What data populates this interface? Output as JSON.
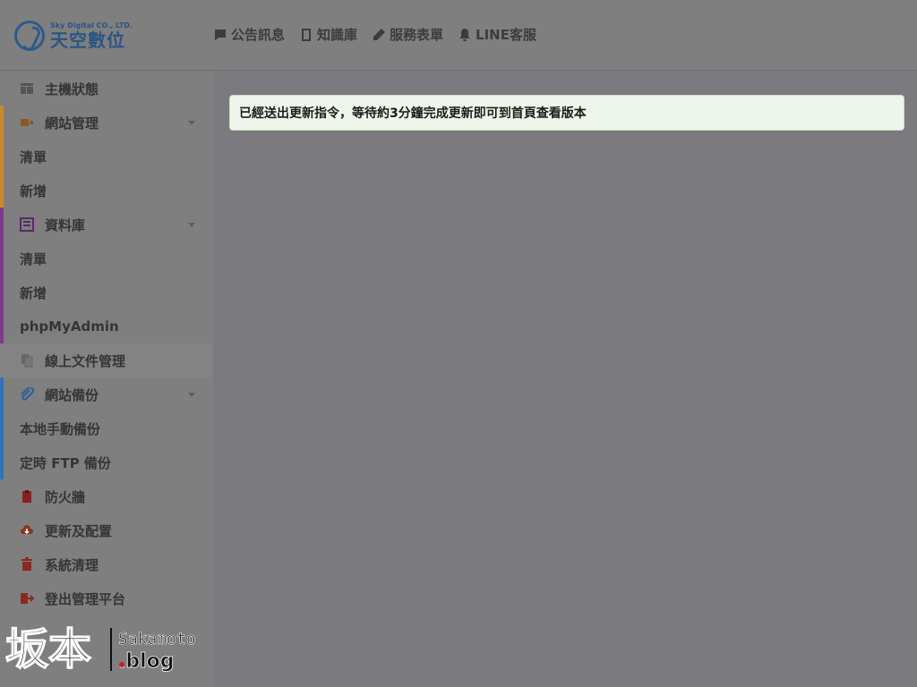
{
  "header": {
    "logo_sub": "Sky Digital CO., LTD.",
    "logo_main": "天空數位",
    "nav": [
      {
        "label": "公告訊息",
        "icon": "comment-icon"
      },
      {
        "label": "知識庫",
        "icon": "book-icon"
      },
      {
        "label": "服務表單",
        "icon": "pencil-icon"
      },
      {
        "label": "LINE客服",
        "icon": "bell-icon"
      }
    ]
  },
  "sidebar": {
    "host_status": "主機狀態",
    "website": {
      "label": "網站管理",
      "items": [
        "清單",
        "新增"
      ]
    },
    "database": {
      "label": "資料庫",
      "items": [
        "清單",
        "新增",
        "phpMyAdmin"
      ]
    },
    "docs": "線上文件管理",
    "backup": {
      "label": "網站備份",
      "items": [
        "本地手動備份",
        "定時 FTP 備份"
      ]
    },
    "firewall": "防火牆",
    "update": "更新及配置",
    "cleanup": "系統清理",
    "logout": "登出管理平台"
  },
  "main": {
    "alert": "已經送出更新指令，等待約3分鐘完成更新即可到首頁查看版本"
  },
  "watermark": {
    "kanji": "坂本",
    "name": "Sakamoto",
    "domain": ".blog"
  },
  "colors": {
    "website_accent": "#c98a2c",
    "database_accent": "#7e3b8c",
    "backup_accent": "#2f73b8",
    "alert_bg": "#eef6ec"
  }
}
